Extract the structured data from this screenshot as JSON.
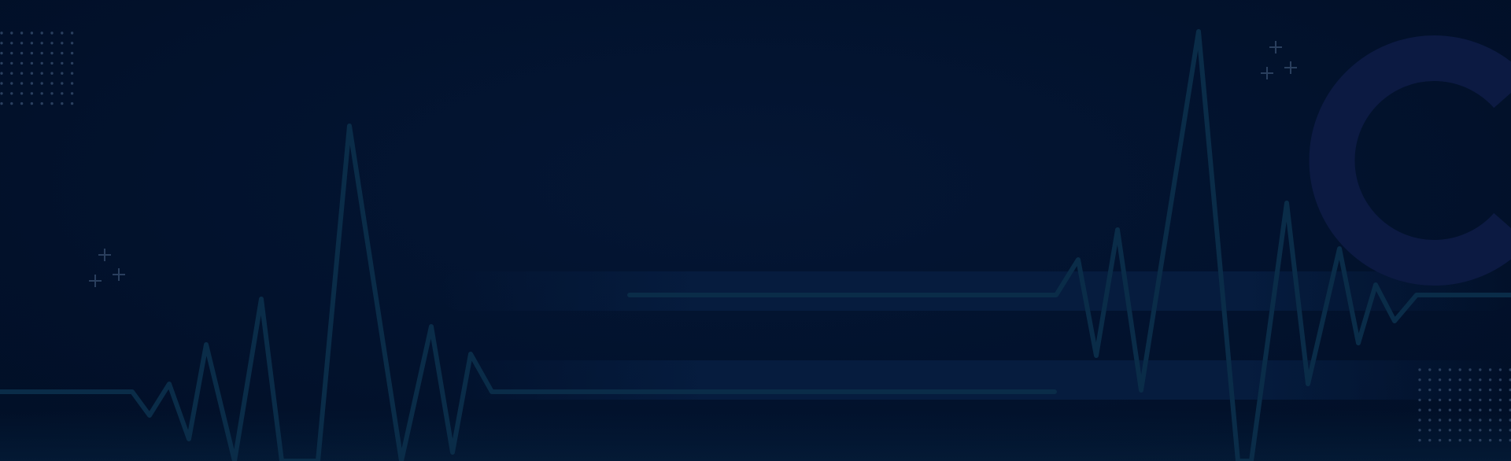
{
  "colors": {
    "background": "#02112b",
    "pulse_line": "#0a2c48",
    "band": "#061d40",
    "ring": "#0c1a42",
    "decor_marks": "#2a3f5e"
  },
  "decorations": {
    "icons": [
      "heartbeat-line-icon",
      "plus-sign-icon",
      "dot-grid-icon",
      "ring-arc-icon"
    ]
  }
}
